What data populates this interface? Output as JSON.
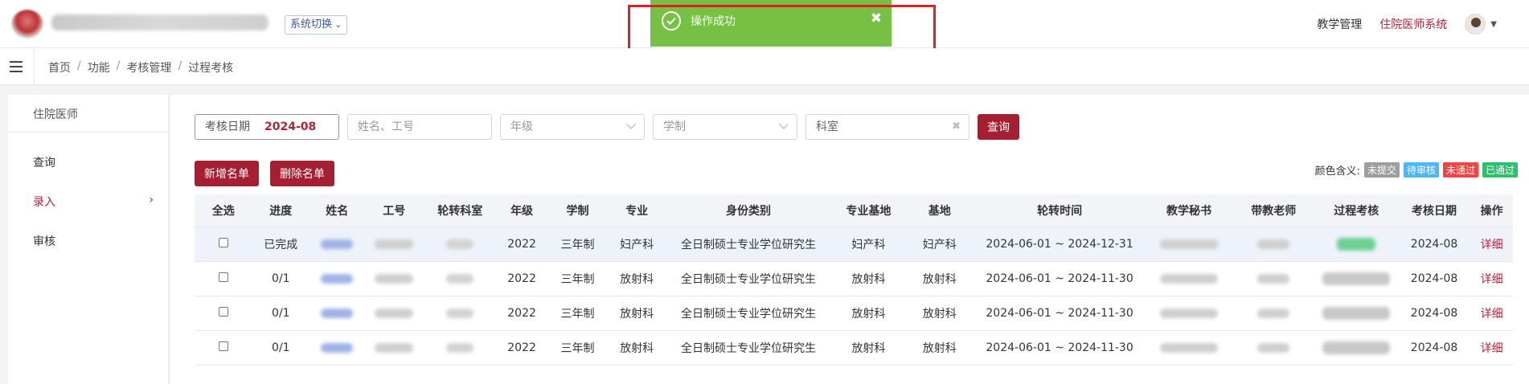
{
  "header": {
    "sys_switch_label": "系统切换",
    "nav": [
      "教学管理",
      "住院医师系统"
    ]
  },
  "toast": {
    "message": "操作成功",
    "close": "✖"
  },
  "breadcrumb": [
    "首页",
    "功能",
    "考核管理",
    "过程考核"
  ],
  "sidebar": {
    "section_title": "住院医师",
    "items": [
      "查询",
      "录入",
      "审核"
    ],
    "arrow": "›"
  },
  "filters": {
    "date_label": "考核日期",
    "date_value": "2024-08",
    "name_placeholder": "姓名、工号",
    "grade_placeholder": "年级",
    "system_placeholder": "学制",
    "dept_value": "科室",
    "query_button": "查询"
  },
  "actions": {
    "add": "新增名单",
    "delete": "删除名单"
  },
  "legend": {
    "label": "颜色含义:",
    "tags": [
      {
        "text": "未提交",
        "color": "#9e9e9e"
      },
      {
        "text": "待审核",
        "color": "#4fb7f1"
      },
      {
        "text": "未通过",
        "color": "#f04545"
      },
      {
        "text": "已通过",
        "color": "#2fbf6e"
      }
    ]
  },
  "table": {
    "headers": [
      "全选",
      "进度",
      "姓名",
      "工号",
      "轮转科室",
      "年级",
      "学制",
      "专业",
      "身份类别",
      "专业基地",
      "基地",
      "轮转时间",
      "教学秘书",
      "带教老师",
      "过程考核",
      "考核日期",
      "操作"
    ],
    "rows": [
      {
        "progress": "已完成",
        "grade": "2022",
        "system": "三年制",
        "major": "妇产科",
        "identity": "全日制硕士专业学位研究生",
        "major_base": "妇产科",
        "base": "妇产科",
        "period": "2024-06-01 ~ 2024-12-31",
        "date": "2024-08",
        "action": "详细"
      },
      {
        "progress": "0/1",
        "grade": "2022",
        "system": "三年制",
        "major": "放射科",
        "identity": "全日制硕士专业学位研究生",
        "major_base": "放射科",
        "base": "放射科",
        "period": "2024-06-01 ~ 2024-11-30",
        "date": "2024-08",
        "action": "详细"
      },
      {
        "progress": "0/1",
        "grade": "2022",
        "system": "三年制",
        "major": "放射科",
        "identity": "全日制硕士专业学位研究生",
        "major_base": "放射科",
        "base": "放射科",
        "period": "2024-06-01 ~ 2024-11-30",
        "date": "2024-08",
        "action": "详细"
      },
      {
        "progress": "0/1",
        "grade": "2022",
        "system": "三年制",
        "major": "放射科",
        "identity": "全日制硕士专业学位研究生",
        "major_base": "放射科",
        "base": "放射科",
        "period": "2024-06-01 ~ 2024-11-30",
        "date": "2024-08",
        "action": "详细"
      }
    ]
  }
}
